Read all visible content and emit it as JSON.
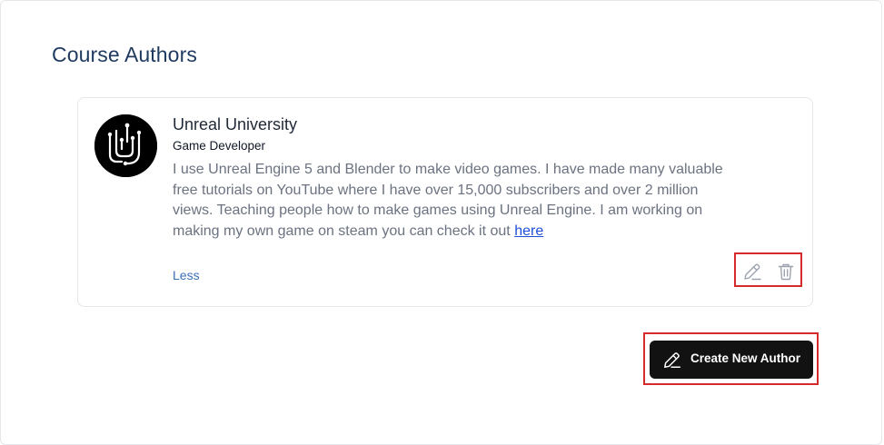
{
  "section": {
    "title": "Course Authors"
  },
  "author": {
    "name": "Unreal University",
    "role": "Game Developer",
    "bio": "I use Unreal Engine 5 and Blender to make video games. I have made many valuable free tutorials on YouTube where I have over 15,000 subscribers and over 2 million views. Teaching people how to make games using Unreal Engine. I am working on making my own game on steam you can check it out",
    "bio_link_label": "here",
    "toggle_label": "Less",
    "avatar_icon": "unreal-university-logo",
    "edit_icon": "pencil-icon",
    "delete_icon": "trash-icon"
  },
  "actions": {
    "create_label": "Create New Author",
    "create_icon": "pencil-icon"
  },
  "colors": {
    "title": "#1f3a5f",
    "link": "#1d4ed8",
    "toggle": "#3b6fb6",
    "primary_button": "#121212",
    "highlight_box": "#d62a2a"
  }
}
